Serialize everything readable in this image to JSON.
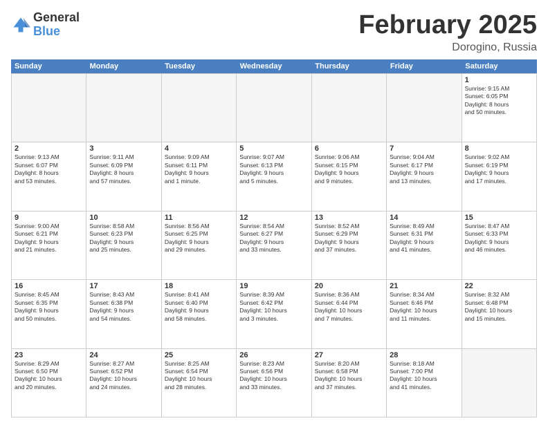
{
  "logo": {
    "general": "General",
    "blue": "Blue"
  },
  "header": {
    "month_year": "February 2025",
    "location": "Dorogino, Russia"
  },
  "days_of_week": [
    "Sunday",
    "Monday",
    "Tuesday",
    "Wednesday",
    "Thursday",
    "Friday",
    "Saturday"
  ],
  "weeks": [
    [
      {
        "day": "",
        "info": ""
      },
      {
        "day": "",
        "info": ""
      },
      {
        "day": "",
        "info": ""
      },
      {
        "day": "",
        "info": ""
      },
      {
        "day": "",
        "info": ""
      },
      {
        "day": "",
        "info": ""
      },
      {
        "day": "1",
        "info": "Sunrise: 9:15 AM\nSunset: 6:05 PM\nDaylight: 8 hours\nand 50 minutes."
      }
    ],
    [
      {
        "day": "2",
        "info": "Sunrise: 9:13 AM\nSunset: 6:07 PM\nDaylight: 8 hours\nand 53 minutes."
      },
      {
        "day": "3",
        "info": "Sunrise: 9:11 AM\nSunset: 6:09 PM\nDaylight: 8 hours\nand 57 minutes."
      },
      {
        "day": "4",
        "info": "Sunrise: 9:09 AM\nSunset: 6:11 PM\nDaylight: 9 hours\nand 1 minute."
      },
      {
        "day": "5",
        "info": "Sunrise: 9:07 AM\nSunset: 6:13 PM\nDaylight: 9 hours\nand 5 minutes."
      },
      {
        "day": "6",
        "info": "Sunrise: 9:06 AM\nSunset: 6:15 PM\nDaylight: 9 hours\nand 9 minutes."
      },
      {
        "day": "7",
        "info": "Sunrise: 9:04 AM\nSunset: 6:17 PM\nDaylight: 9 hours\nand 13 minutes."
      },
      {
        "day": "8",
        "info": "Sunrise: 9:02 AM\nSunset: 6:19 PM\nDaylight: 9 hours\nand 17 minutes."
      }
    ],
    [
      {
        "day": "9",
        "info": "Sunrise: 9:00 AM\nSunset: 6:21 PM\nDaylight: 9 hours\nand 21 minutes."
      },
      {
        "day": "10",
        "info": "Sunrise: 8:58 AM\nSunset: 6:23 PM\nDaylight: 9 hours\nand 25 minutes."
      },
      {
        "day": "11",
        "info": "Sunrise: 8:56 AM\nSunset: 6:25 PM\nDaylight: 9 hours\nand 29 minutes."
      },
      {
        "day": "12",
        "info": "Sunrise: 8:54 AM\nSunset: 6:27 PM\nDaylight: 9 hours\nand 33 minutes."
      },
      {
        "day": "13",
        "info": "Sunrise: 8:52 AM\nSunset: 6:29 PM\nDaylight: 9 hours\nand 37 minutes."
      },
      {
        "day": "14",
        "info": "Sunrise: 8:49 AM\nSunset: 6:31 PM\nDaylight: 9 hours\nand 41 minutes."
      },
      {
        "day": "15",
        "info": "Sunrise: 8:47 AM\nSunset: 6:33 PM\nDaylight: 9 hours\nand 46 minutes."
      }
    ],
    [
      {
        "day": "16",
        "info": "Sunrise: 8:45 AM\nSunset: 6:35 PM\nDaylight: 9 hours\nand 50 minutes."
      },
      {
        "day": "17",
        "info": "Sunrise: 8:43 AM\nSunset: 6:38 PM\nDaylight: 9 hours\nand 54 minutes."
      },
      {
        "day": "18",
        "info": "Sunrise: 8:41 AM\nSunset: 6:40 PM\nDaylight: 9 hours\nand 58 minutes."
      },
      {
        "day": "19",
        "info": "Sunrise: 8:39 AM\nSunset: 6:42 PM\nDaylight: 10 hours\nand 3 minutes."
      },
      {
        "day": "20",
        "info": "Sunrise: 8:36 AM\nSunset: 6:44 PM\nDaylight: 10 hours\nand 7 minutes."
      },
      {
        "day": "21",
        "info": "Sunrise: 8:34 AM\nSunset: 6:46 PM\nDaylight: 10 hours\nand 11 minutes."
      },
      {
        "day": "22",
        "info": "Sunrise: 8:32 AM\nSunset: 6:48 PM\nDaylight: 10 hours\nand 15 minutes."
      }
    ],
    [
      {
        "day": "23",
        "info": "Sunrise: 8:29 AM\nSunset: 6:50 PM\nDaylight: 10 hours\nand 20 minutes."
      },
      {
        "day": "24",
        "info": "Sunrise: 8:27 AM\nSunset: 6:52 PM\nDaylight: 10 hours\nand 24 minutes."
      },
      {
        "day": "25",
        "info": "Sunrise: 8:25 AM\nSunset: 6:54 PM\nDaylight: 10 hours\nand 28 minutes."
      },
      {
        "day": "26",
        "info": "Sunrise: 8:23 AM\nSunset: 6:56 PM\nDaylight: 10 hours\nand 33 minutes."
      },
      {
        "day": "27",
        "info": "Sunrise: 8:20 AM\nSunset: 6:58 PM\nDaylight: 10 hours\nand 37 minutes."
      },
      {
        "day": "28",
        "info": "Sunrise: 8:18 AM\nSunset: 7:00 PM\nDaylight: 10 hours\nand 41 minutes."
      },
      {
        "day": "",
        "info": ""
      }
    ]
  ]
}
